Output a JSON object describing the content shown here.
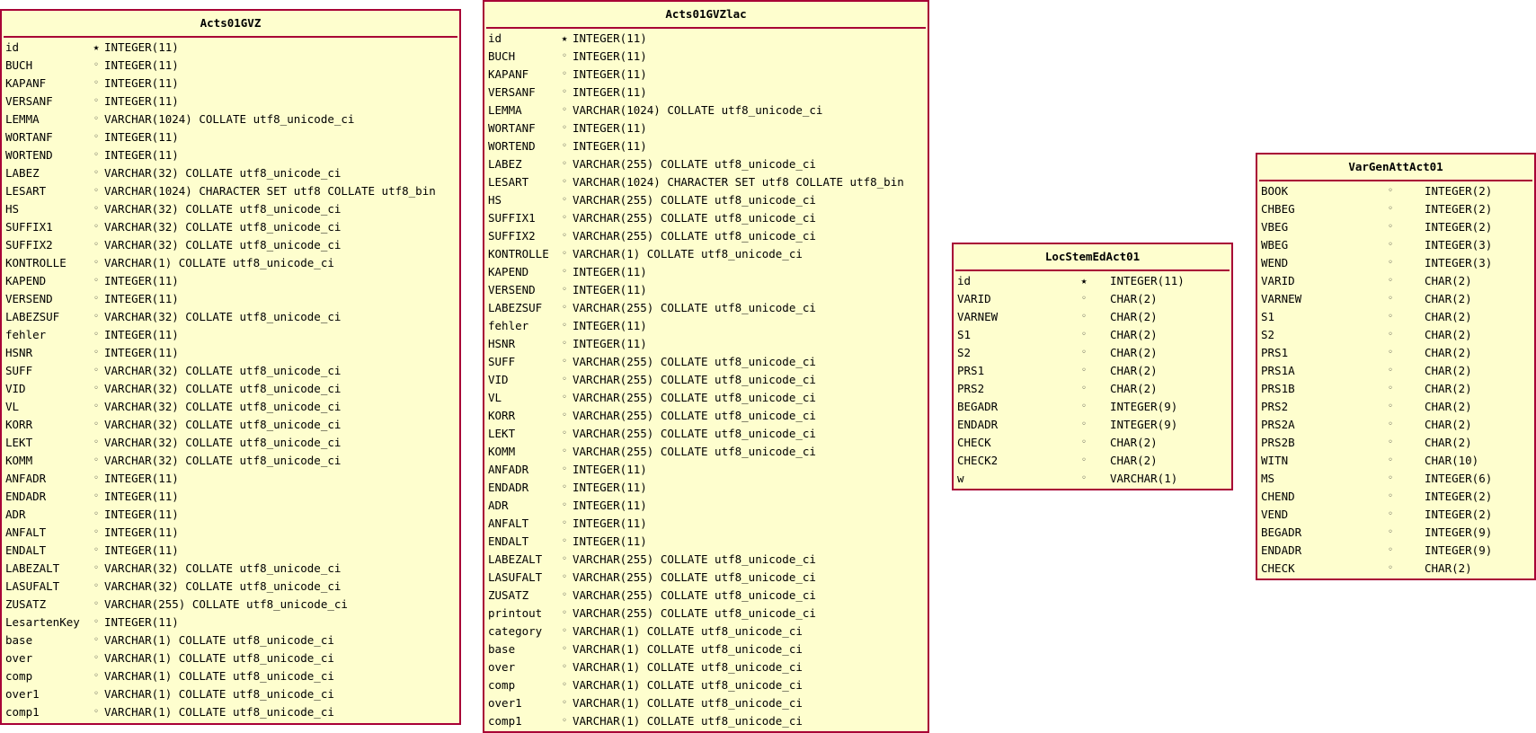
{
  "diagram": {
    "colors": {
      "entity_fill": "#fefece",
      "entity_border": "#a80036"
    },
    "markers": {
      "primary_key": "★",
      "field": "◦"
    },
    "entities": [
      {
        "name": "Acts01GVZ",
        "fields": [
          {
            "name": "id",
            "key": "primary",
            "type": "INTEGER(11)"
          },
          {
            "name": "BUCH",
            "key": "",
            "type": "INTEGER(11)"
          },
          {
            "name": "KAPANF",
            "key": "",
            "type": "INTEGER(11)"
          },
          {
            "name": "VERSANF",
            "key": "",
            "type": "INTEGER(11)"
          },
          {
            "name": "LEMMA",
            "key": "",
            "type": "VARCHAR(1024) COLLATE utf8_unicode_ci"
          },
          {
            "name": "WORTANF",
            "key": "",
            "type": "INTEGER(11)"
          },
          {
            "name": "WORTEND",
            "key": "",
            "type": "INTEGER(11)"
          },
          {
            "name": "LABEZ",
            "key": "",
            "type": "VARCHAR(32) COLLATE utf8_unicode_ci"
          },
          {
            "name": "LESART",
            "key": "",
            "type": "VARCHAR(1024) CHARACTER SET utf8 COLLATE utf8_bin"
          },
          {
            "name": "HS",
            "key": "",
            "type": "VARCHAR(32) COLLATE utf8_unicode_ci"
          },
          {
            "name": "SUFFIX1",
            "key": "",
            "type": "VARCHAR(32) COLLATE utf8_unicode_ci"
          },
          {
            "name": "SUFFIX2",
            "key": "",
            "type": "VARCHAR(32) COLLATE utf8_unicode_ci"
          },
          {
            "name": "KONTROLLE",
            "key": "",
            "type": "VARCHAR(1) COLLATE utf8_unicode_ci"
          },
          {
            "name": "KAPEND",
            "key": "",
            "type": "INTEGER(11)"
          },
          {
            "name": "VERSEND",
            "key": "",
            "type": "INTEGER(11)"
          },
          {
            "name": "LABEZSUF",
            "key": "",
            "type": "VARCHAR(32) COLLATE utf8_unicode_ci"
          },
          {
            "name": "fehler",
            "key": "",
            "type": "INTEGER(11)"
          },
          {
            "name": "HSNR",
            "key": "",
            "type": "INTEGER(11)"
          },
          {
            "name": "SUFF",
            "key": "",
            "type": "VARCHAR(32) COLLATE utf8_unicode_ci"
          },
          {
            "name": "VID",
            "key": "",
            "type": "VARCHAR(32) COLLATE utf8_unicode_ci"
          },
          {
            "name": "VL",
            "key": "",
            "type": "VARCHAR(32) COLLATE utf8_unicode_ci"
          },
          {
            "name": "KORR",
            "key": "",
            "type": "VARCHAR(32) COLLATE utf8_unicode_ci"
          },
          {
            "name": "LEKT",
            "key": "",
            "type": "VARCHAR(32) COLLATE utf8_unicode_ci"
          },
          {
            "name": "KOMM",
            "key": "",
            "type": "VARCHAR(32) COLLATE utf8_unicode_ci"
          },
          {
            "name": "ANFADR",
            "key": "",
            "type": "INTEGER(11)"
          },
          {
            "name": "ENDADR",
            "key": "",
            "type": "INTEGER(11)"
          },
          {
            "name": "ADR",
            "key": "",
            "type": "INTEGER(11)"
          },
          {
            "name": "ANFALT",
            "key": "",
            "type": "INTEGER(11)"
          },
          {
            "name": "ENDALT",
            "key": "",
            "type": "INTEGER(11)"
          },
          {
            "name": "LABEZALT",
            "key": "",
            "type": "VARCHAR(32) COLLATE utf8_unicode_ci"
          },
          {
            "name": "LASUFALT",
            "key": "",
            "type": "VARCHAR(32) COLLATE utf8_unicode_ci"
          },
          {
            "name": "ZUSATZ",
            "key": "",
            "type": "VARCHAR(255) COLLATE utf8_unicode_ci"
          },
          {
            "name": "LesartenKey",
            "key": "",
            "type": "INTEGER(11)"
          },
          {
            "name": "base",
            "key": "",
            "type": "VARCHAR(1) COLLATE utf8_unicode_ci"
          },
          {
            "name": "over",
            "key": "",
            "type": "VARCHAR(1) COLLATE utf8_unicode_ci"
          },
          {
            "name": "comp",
            "key": "",
            "type": "VARCHAR(1) COLLATE utf8_unicode_ci"
          },
          {
            "name": "over1",
            "key": "",
            "type": "VARCHAR(1) COLLATE utf8_unicode_ci"
          },
          {
            "name": "comp1",
            "key": "",
            "type": "VARCHAR(1) COLLATE utf8_unicode_ci"
          }
        ]
      },
      {
        "name": "Acts01GVZlac",
        "fields": [
          {
            "name": "id",
            "key": "primary",
            "type": "INTEGER(11)"
          },
          {
            "name": "BUCH",
            "key": "",
            "type": "INTEGER(11)"
          },
          {
            "name": "KAPANF",
            "key": "",
            "type": "INTEGER(11)"
          },
          {
            "name": "VERSANF",
            "key": "",
            "type": "INTEGER(11)"
          },
          {
            "name": "LEMMA",
            "key": "",
            "type": "VARCHAR(1024) COLLATE utf8_unicode_ci"
          },
          {
            "name": "WORTANF",
            "key": "",
            "type": "INTEGER(11)"
          },
          {
            "name": "WORTEND",
            "key": "",
            "type": "INTEGER(11)"
          },
          {
            "name": "LABEZ",
            "key": "",
            "type": "VARCHAR(255) COLLATE utf8_unicode_ci"
          },
          {
            "name": "LESART",
            "key": "",
            "type": "VARCHAR(1024) CHARACTER SET utf8 COLLATE utf8_bin"
          },
          {
            "name": "HS",
            "key": "",
            "type": "VARCHAR(255) COLLATE utf8_unicode_ci"
          },
          {
            "name": "SUFFIX1",
            "key": "",
            "type": "VARCHAR(255) COLLATE utf8_unicode_ci"
          },
          {
            "name": "SUFFIX2",
            "key": "",
            "type": "VARCHAR(255) COLLATE utf8_unicode_ci"
          },
          {
            "name": "KONTROLLE",
            "key": "",
            "type": "VARCHAR(1) COLLATE utf8_unicode_ci"
          },
          {
            "name": "KAPEND",
            "key": "",
            "type": "INTEGER(11)"
          },
          {
            "name": "VERSEND",
            "key": "",
            "type": "INTEGER(11)"
          },
          {
            "name": "LABEZSUF",
            "key": "",
            "type": "VARCHAR(255) COLLATE utf8_unicode_ci"
          },
          {
            "name": "fehler",
            "key": "",
            "type": "INTEGER(11)"
          },
          {
            "name": "HSNR",
            "key": "",
            "type": "INTEGER(11)"
          },
          {
            "name": "SUFF",
            "key": "",
            "type": "VARCHAR(255) COLLATE utf8_unicode_ci"
          },
          {
            "name": "VID",
            "key": "",
            "type": "VARCHAR(255) COLLATE utf8_unicode_ci"
          },
          {
            "name": "VL",
            "key": "",
            "type": "VARCHAR(255) COLLATE utf8_unicode_ci"
          },
          {
            "name": "KORR",
            "key": "",
            "type": "VARCHAR(255) COLLATE utf8_unicode_ci"
          },
          {
            "name": "LEKT",
            "key": "",
            "type": "VARCHAR(255) COLLATE utf8_unicode_ci"
          },
          {
            "name": "KOMM",
            "key": "",
            "type": "VARCHAR(255) COLLATE utf8_unicode_ci"
          },
          {
            "name": "ANFADR",
            "key": "",
            "type": "INTEGER(11)"
          },
          {
            "name": "ENDADR",
            "key": "",
            "type": "INTEGER(11)"
          },
          {
            "name": "ADR",
            "key": "",
            "type": "INTEGER(11)"
          },
          {
            "name": "ANFALT",
            "key": "",
            "type": "INTEGER(11)"
          },
          {
            "name": "ENDALT",
            "key": "",
            "type": "INTEGER(11)"
          },
          {
            "name": "LABEZALT",
            "key": "",
            "type": "VARCHAR(255) COLLATE utf8_unicode_ci"
          },
          {
            "name": "LASUFALT",
            "key": "",
            "type": "VARCHAR(255) COLLATE utf8_unicode_ci"
          },
          {
            "name": "ZUSATZ",
            "key": "",
            "type": "VARCHAR(255) COLLATE utf8_unicode_ci"
          },
          {
            "name": "printout",
            "key": "",
            "type": "VARCHAR(255) COLLATE utf8_unicode_ci"
          },
          {
            "name": "category",
            "key": "",
            "type": "VARCHAR(1) COLLATE utf8_unicode_ci"
          },
          {
            "name": "base",
            "key": "",
            "type": "VARCHAR(1) COLLATE utf8_unicode_ci"
          },
          {
            "name": "over",
            "key": "",
            "type": "VARCHAR(1) COLLATE utf8_unicode_ci"
          },
          {
            "name": "comp",
            "key": "",
            "type": "VARCHAR(1) COLLATE utf8_unicode_ci"
          },
          {
            "name": "over1",
            "key": "",
            "type": "VARCHAR(1) COLLATE utf8_unicode_ci"
          },
          {
            "name": "comp1",
            "key": "",
            "type": "VARCHAR(1) COLLATE utf8_unicode_ci"
          }
        ]
      },
      {
        "name": "LocStemEdAct01",
        "fields": [
          {
            "name": "id",
            "key": "primary",
            "type": "INTEGER(11)"
          },
          {
            "name": "VARID",
            "key": "",
            "type": "CHAR(2)"
          },
          {
            "name": "VARNEW",
            "key": "",
            "type": "CHAR(2)"
          },
          {
            "name": "S1",
            "key": "",
            "type": "CHAR(2)"
          },
          {
            "name": "S2",
            "key": "",
            "type": "CHAR(2)"
          },
          {
            "name": "PRS1",
            "key": "",
            "type": "CHAR(2)"
          },
          {
            "name": "PRS2",
            "key": "",
            "type": "CHAR(2)"
          },
          {
            "name": "BEGADR",
            "key": "",
            "type": "INTEGER(9)"
          },
          {
            "name": "ENDADR",
            "key": "",
            "type": "INTEGER(9)"
          },
          {
            "name": "CHECK",
            "key": "",
            "type": "CHAR(2)"
          },
          {
            "name": "CHECK2",
            "key": "",
            "type": "CHAR(2)"
          },
          {
            "name": "w",
            "key": "",
            "type": "VARCHAR(1)"
          }
        ]
      },
      {
        "name": "VarGenAttAct01",
        "fields": [
          {
            "name": "BOOK",
            "key": "",
            "type": "INTEGER(2)"
          },
          {
            "name": "CHBEG",
            "key": "",
            "type": "INTEGER(2)"
          },
          {
            "name": "VBEG",
            "key": "",
            "type": "INTEGER(2)"
          },
          {
            "name": "WBEG",
            "key": "",
            "type": "INTEGER(3)"
          },
          {
            "name": "WEND",
            "key": "",
            "type": "INTEGER(3)"
          },
          {
            "name": "VARID",
            "key": "",
            "type": "CHAR(2)"
          },
          {
            "name": "VARNEW",
            "key": "",
            "type": "CHAR(2)"
          },
          {
            "name": "S1",
            "key": "",
            "type": "CHAR(2)"
          },
          {
            "name": "S2",
            "key": "",
            "type": "CHAR(2)"
          },
          {
            "name": "PRS1",
            "key": "",
            "type": "CHAR(2)"
          },
          {
            "name": "PRS1A",
            "key": "",
            "type": "CHAR(2)"
          },
          {
            "name": "PRS1B",
            "key": "",
            "type": "CHAR(2)"
          },
          {
            "name": "PRS2",
            "key": "",
            "type": "CHAR(2)"
          },
          {
            "name": "PRS2A",
            "key": "",
            "type": "CHAR(2)"
          },
          {
            "name": "PRS2B",
            "key": "",
            "type": "CHAR(2)"
          },
          {
            "name": "WITN",
            "key": "",
            "type": "CHAR(10)"
          },
          {
            "name": "MS",
            "key": "",
            "type": "INTEGER(6)"
          },
          {
            "name": "CHEND",
            "key": "",
            "type": "INTEGER(2)"
          },
          {
            "name": "VEND",
            "key": "",
            "type": "INTEGER(2)"
          },
          {
            "name": "BEGADR",
            "key": "",
            "type": "INTEGER(9)"
          },
          {
            "name": "ENDADR",
            "key": "",
            "type": "INTEGER(9)"
          },
          {
            "name": "CHECK",
            "key": "",
            "type": "CHAR(2)"
          }
        ]
      }
    ]
  }
}
